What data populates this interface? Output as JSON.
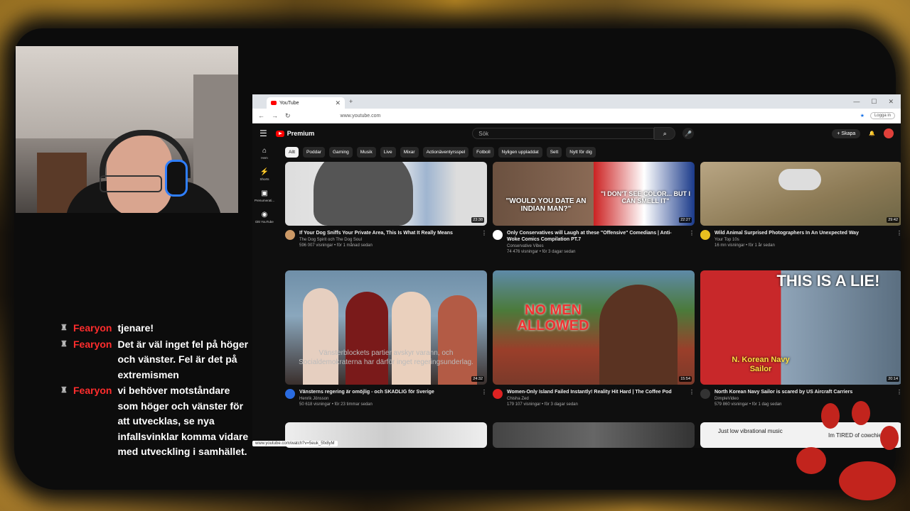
{
  "stream": {
    "chat": [
      {
        "user": "Fearyon",
        "text": "tjenare!"
      },
      {
        "user": "Fearyon",
        "text": "Det är väl inget fel på höger och vänster. Fel är det på extremismen"
      },
      {
        "user": "Fearyon",
        "text": "vi behöver motståndare som höger och vänster för att utvecklas, se nya infallsvinklar komma vidare med utveckling i samhället."
      }
    ]
  },
  "browser": {
    "tab_title": "YouTube",
    "url": "www.youtube.com",
    "login_label": "Logga in",
    "status_url": "www.youtube.com/watch?v=5euk_5fx8yM"
  },
  "youtube": {
    "logo_label": "Premium",
    "search_placeholder": "Sök",
    "create_label": "Skapa",
    "sidebar": [
      {
        "label": "Hem"
      },
      {
        "label": "Shorts"
      },
      {
        "label": "Prenumerati..."
      },
      {
        "label": "Ditt YouTube"
      }
    ],
    "chips": [
      "Allt",
      "Poddar",
      "Gaming",
      "Musik",
      "Live",
      "Mixar",
      "Actionäventyrsspel",
      "Fotboll",
      "Nyligen uppladdat",
      "Sett",
      "Nytt för dig"
    ],
    "videos": [
      {
        "title": "If Your Dog Sniffs Your Private Area, This Is What It Really Means",
        "channel": "The Dog Spirit och The Dog Soul",
        "stats": "596 007 visningar • för 1 månad sedan",
        "duration": "23:38",
        "channel_color": "#c96"
      },
      {
        "title": "Only Conservatives will Laugh at these \"Offensive\" Comedians | Anti-Woke Comics Compilation PT.7",
        "channel": "Conservative Vibes",
        "stats": "74 476 visningar • för 3 dagar sedan",
        "duration": "22:27",
        "channel_color": "#fff",
        "overlay_left": "\"WOULD YOU DATE AN INDIAN MAN?\"",
        "overlay_right": "\"I DON'T SEE COLOR... BUT I CAN SMELL IT\""
      },
      {
        "title": "Wild Animal Surprised Photographers In An Unexpected Way",
        "channel": "Your Top 10s",
        "stats": "16 mn visningar • för 1 år sedan",
        "duration": "29:42",
        "channel_color": "#e8c020"
      },
      {
        "title": "Vänsterns regering är omöjlig - och SKADLIG för Sverige",
        "channel": "Henrik Jönsson",
        "stats": "50 618 visningar • för 23 timmar sedan",
        "duration": "24:32",
        "channel_color": "#2a6be0",
        "hover_text": "Vänsterblockets partier avskyr varann, och Socialdemokraterna har därför inget regeringsunderlag."
      },
      {
        "title": "Women-Only Island Failed Instantly! Reality Hit Hard | The Coffee Pod",
        "channel": "Chisha Zed",
        "stats": "179 107 visningar • för 3 dagar sedan",
        "duration": "15:54",
        "channel_color": "#d22",
        "overlay": "NO MEN ALLOWED"
      },
      {
        "title": "North Korean Navy Sailor is scared by US Aircraft Carriers",
        "channel": "DimpleVideo",
        "stats": "579 860 visningar • för 1 dag sedan",
        "duration": "20:14",
        "channel_color": "#333",
        "overlay_top": "THIS IS A LIE!",
        "overlay_bottom": "N. Korean Navy Sailor"
      }
    ],
    "partial_comment": "Just low vibrational music",
    "partial_comment2": "Im TIRED of cowchie rap"
  },
  "colors": {
    "accent": "#ff0000",
    "chat_user": "#ff2d2d"
  }
}
